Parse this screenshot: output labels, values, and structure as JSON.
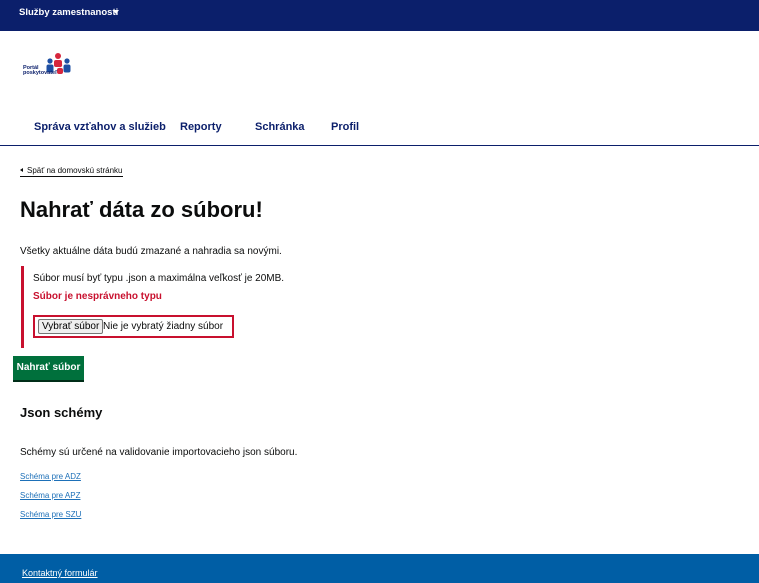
{
  "topbar": {
    "service_label": "Služby zamestnanosti"
  },
  "logo": {
    "line1": "Portál",
    "line2": "poskytovateľ"
  },
  "nav": {
    "items": [
      {
        "label": "Správa vzťahov a služieb"
      },
      {
        "label": "Reporty"
      },
      {
        "label": "Schránka"
      },
      {
        "label": "Profil"
      }
    ]
  },
  "back_link": "Späť na domovskú stránku",
  "page_title": "Nahrať dáta zo súboru!",
  "lead_text": "Všetky aktuálne dáta budú zmazané a nahradia sa novými.",
  "upload_field": {
    "hint": "Súbor musí byť typu .json a maximálna veľkosť je 20MB.",
    "error": "Súbor je nesprávneho typu",
    "choose_label": "Vybrať súbor",
    "no_file_text": "Nie je vybratý žiadny súbor"
  },
  "upload_button": "Nahrať súbor",
  "schemes": {
    "heading": "Json schémy",
    "description": "Schémy sú určené na validovanie importovacieho json súboru.",
    "links": [
      {
        "label": "Schéma pre ADZ"
      },
      {
        "label": "Schéma pre APZ"
      },
      {
        "label": "Schéma pre SZU"
      }
    ]
  },
  "footer": {
    "contact_link": "Kontaktný formulár"
  },
  "colors": {
    "brand_navy": "#0b1f6b",
    "error_red": "#c8102e",
    "button_green": "#00703c",
    "link_blue": "#1d70b8",
    "footer_blue": "#005ea5"
  }
}
